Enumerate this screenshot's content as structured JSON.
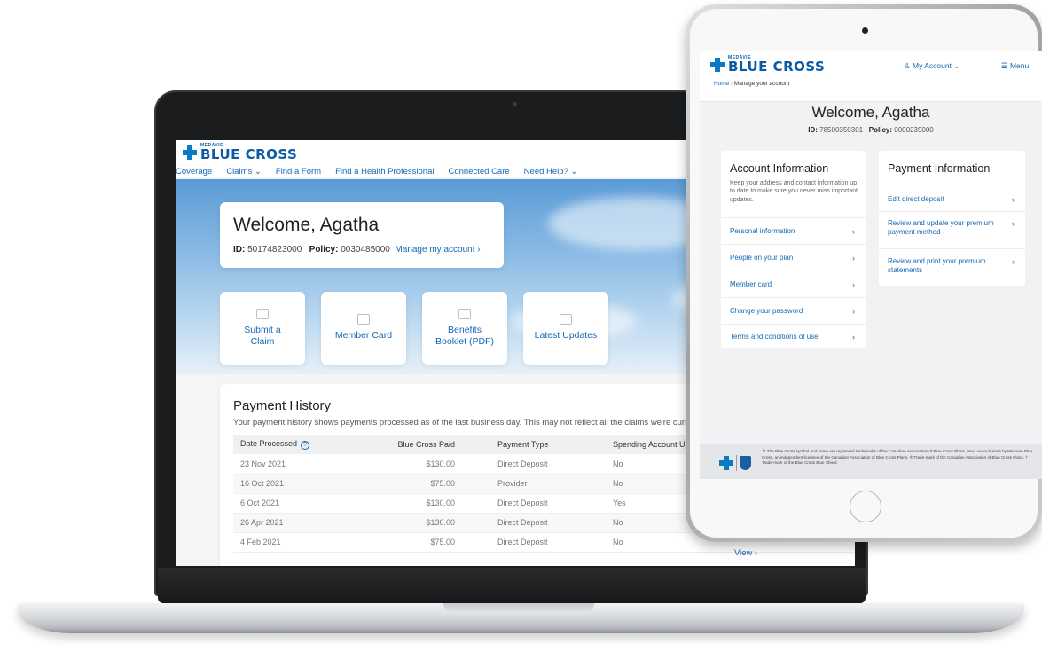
{
  "brand": {
    "small": "MEDAVIE",
    "name": "BLUE CROSS",
    "color": "#0b5aa6"
  },
  "laptop": {
    "nav": [
      "Coverage",
      "Claims ⌄",
      "Find a Form",
      "Find a Health Professional",
      "Connected Care",
      "Need Help? ⌄"
    ],
    "welcome": {
      "title": "Welcome, Agatha",
      "id_label": "ID:",
      "id_value": "50174823000",
      "policy_label": "Policy:",
      "policy_value": "0030485000",
      "manage_link": "Manage my account ›"
    },
    "tiles": [
      {
        "label": "Submit a Claim",
        "icon": "submit-claim-icon"
      },
      {
        "label": "Member Card",
        "icon": "member-card-icon"
      },
      {
        "label": "Benefits Booklet (PDF)",
        "icon": "pdf-icon"
      },
      {
        "label": "Latest Updates",
        "icon": "updates-icon"
      }
    ],
    "payment_history": {
      "title": "Payment History",
      "description": "Your payment history shows payments processed as of the last business day. This may not reflect all the claims we're curr",
      "columns": [
        "Date Processed",
        "Blue Cross Paid",
        "Payment Type",
        "Spending Account Used"
      ],
      "rows": [
        [
          "23 Nov 2021",
          "$130.00",
          "Direct Deposit",
          "No"
        ],
        [
          "16 Oct 2021",
          "$75.00",
          "Provider",
          "No"
        ],
        [
          "6 Oct 2021",
          "$130.00",
          "Direct Deposit",
          "Yes"
        ],
        [
          "26 Apr 2021",
          "$130.00",
          "Direct Deposit",
          "No"
        ],
        [
          "4 Feb 2021",
          "$75.00",
          "Direct Deposit",
          "No"
        ]
      ],
      "view_link": "View ›"
    }
  },
  "tablet": {
    "my_account": "My Account ⌄",
    "menu": "☰ Menu",
    "breadcrumb": {
      "home": "Home",
      "current": "Manage your account"
    },
    "welcome": "Welcome, Agatha",
    "id_label": "ID:",
    "id_value": "78500350301",
    "policy_label": "Policy:",
    "policy_value": "0000239000",
    "account_info": {
      "title": "Account Information",
      "subtitle": "Keep your address and contact information up to date to make sure you never miss important updates.",
      "items": [
        "Personal information",
        "People on your plan",
        "Member card",
        "Change your password",
        "Terms and conditions of use"
      ]
    },
    "payment_info": {
      "title": "Payment Information",
      "items": [
        "Edit direct deposit",
        "Review and update your premium payment method",
        "Review and print your premium statements"
      ]
    },
    "footer_text": "™ The Blue Cross symbol and name are registered trademarks of the Canadian Association of Blue Cross Plans, used under license by Medavie Blue Cross, an independent licensee of the Canadian Association of Blue Cross Plans. ® Trade-mark of the Canadian Association of Blue Cross Plans. † Trade-mark of the Blue Cross Blue Shield"
  }
}
